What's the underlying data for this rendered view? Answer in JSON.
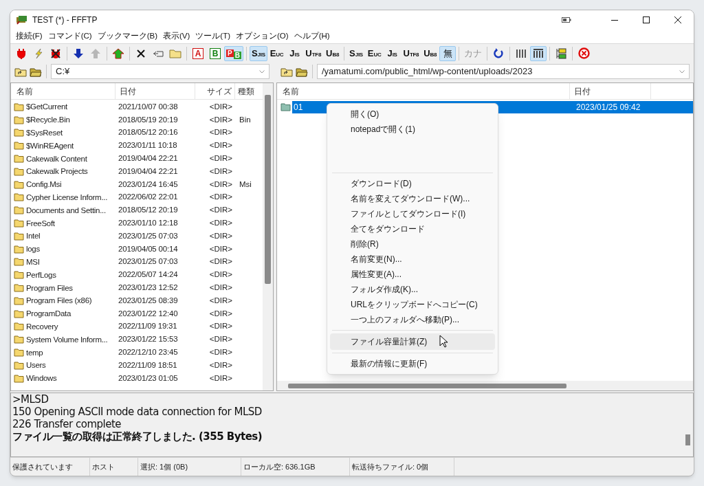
{
  "window": {
    "title": "TEST (*) - FFFTP"
  },
  "menu": [
    "接続(F)",
    "コマンド(C)",
    "ブックマーク(B)",
    "表示(V)",
    "ツール(T)",
    "オプション(O)",
    "ヘルプ(H)"
  ],
  "toolbar": [
    {
      "kind": "connect",
      "selected": false,
      "disabled": false
    },
    {
      "kind": "quick-connect",
      "selected": false,
      "disabled": false
    },
    {
      "kind": "disconnect",
      "selected": false,
      "disabled": false
    },
    {
      "kind": "sep"
    },
    {
      "kind": "download",
      "selected": false,
      "disabled": false
    },
    {
      "kind": "upload",
      "selected": false,
      "disabled": true
    },
    {
      "kind": "sep"
    },
    {
      "kind": "mirror",
      "selected": false,
      "disabled": false
    },
    {
      "kind": "sep"
    },
    {
      "kind": "delete",
      "selected": false,
      "disabled": false
    },
    {
      "kind": "rename",
      "selected": false,
      "disabled": false
    },
    {
      "kind": "mkdir",
      "selected": false,
      "disabled": false
    },
    {
      "kind": "sep"
    },
    {
      "kind": "boxed",
      "main": "A",
      "color": "#d01010",
      "selected": false,
      "disabled": false
    },
    {
      "kind": "boxed",
      "main": "B",
      "color": "#108010",
      "selected": false,
      "disabled": false
    },
    {
      "kind": "auto",
      "main": "P",
      "sub": "B",
      "selected": true,
      "disabled": false
    },
    {
      "kind": "sep"
    },
    {
      "kind": "letter",
      "main": "S",
      "sub": "JIS",
      "selected": true,
      "disabled": false
    },
    {
      "kind": "letter",
      "main": "E",
      "sub": "UC",
      "selected": false,
      "disabled": false
    },
    {
      "kind": "letter",
      "main": "J",
      "sub": "IS",
      "selected": false,
      "disabled": false
    },
    {
      "kind": "letter",
      "main": "U",
      "sub": "TF8",
      "selected": false,
      "disabled": false
    },
    {
      "kind": "letter",
      "main": "U",
      "sub": "B8",
      "selected": false,
      "disabled": false
    },
    {
      "kind": "sep"
    },
    {
      "kind": "letter",
      "main": "S",
      "sub": "JIS",
      "selected": false,
      "disabled": false
    },
    {
      "kind": "letter",
      "main": "E",
      "sub": "UC",
      "selected": false,
      "disabled": false
    },
    {
      "kind": "letter",
      "main": "J",
      "sub": "IS",
      "selected": false,
      "disabled": false
    },
    {
      "kind": "letter",
      "main": "U",
      "sub": "TF8",
      "selected": false,
      "disabled": false
    },
    {
      "kind": "letter",
      "main": "U",
      "sub": "B8",
      "selected": false,
      "disabled": false
    },
    {
      "kind": "glyph",
      "main": "無",
      "selected": true,
      "disabled": false
    },
    {
      "kind": "sep"
    },
    {
      "kind": "glyph",
      "main": "カナ",
      "selected": false,
      "disabled": true
    },
    {
      "kind": "sep"
    },
    {
      "kind": "refresh",
      "selected": false,
      "disabled": false
    },
    {
      "kind": "sep"
    },
    {
      "kind": "list-view",
      "selected": false,
      "disabled": false
    },
    {
      "kind": "detail-view",
      "selected": true,
      "disabled": false
    },
    {
      "kind": "sep"
    },
    {
      "kind": "tree",
      "selected": false,
      "disabled": false
    },
    {
      "kind": "sep"
    },
    {
      "kind": "stop",
      "selected": false,
      "disabled": false
    }
  ],
  "local": {
    "path": "C:¥",
    "columns": [
      "名前",
      "日付",
      "サイズ",
      "種類"
    ],
    "rows": [
      {
        "name": "$GetCurrent",
        "date": "2021/10/07 00:38",
        "size": "<DIR>"
      },
      {
        "name": "$Recycle.Bin",
        "date": "2018/05/19 20:19",
        "size": "<DIR>",
        "type": "Bin"
      },
      {
        "name": "$SysReset",
        "date": "2018/05/12 20:16",
        "size": "<DIR>"
      },
      {
        "name": "$WinREAgent",
        "date": "2023/01/11 10:18",
        "size": "<DIR>"
      },
      {
        "name": "Cakewalk Content",
        "date": "2019/04/04 22:21",
        "size": "<DIR>"
      },
      {
        "name": "Cakewalk Projects",
        "date": "2019/04/04 22:21",
        "size": "<DIR>"
      },
      {
        "name": "Config.Msi",
        "date": "2023/01/24 16:45",
        "size": "<DIR>",
        "type": "Msi"
      },
      {
        "name": "Cypher License Inform...",
        "date": "2022/06/02 22:01",
        "size": "<DIR>"
      },
      {
        "name": "Documents and Settin...",
        "date": "2018/05/12 20:19",
        "size": "<DIR>"
      },
      {
        "name": "FreeSoft",
        "date": "2023/01/10 12:18",
        "size": "<DIR>"
      },
      {
        "name": "Intel",
        "date": "2023/01/25 07:03",
        "size": "<DIR>"
      },
      {
        "name": "logs",
        "date": "2019/04/05 00:14",
        "size": "<DIR>"
      },
      {
        "name": "MSI",
        "date": "2023/01/25 07:03",
        "size": "<DIR>"
      },
      {
        "name": "PerfLogs",
        "date": "2022/05/07 14:24",
        "size": "<DIR>"
      },
      {
        "name": "Program Files",
        "date": "2023/01/23 12:52",
        "size": "<DIR>"
      },
      {
        "name": "Program Files (x86)",
        "date": "2023/01/25 08:39",
        "size": "<DIR>"
      },
      {
        "name": "ProgramData",
        "date": "2023/01/22 12:40",
        "size": "<DIR>"
      },
      {
        "name": "Recovery",
        "date": "2022/11/09 19:31",
        "size": "<DIR>"
      },
      {
        "name": "System Volume Inform...",
        "date": "2023/01/22 15:53",
        "size": "<DIR>"
      },
      {
        "name": "temp",
        "date": "2022/12/10 23:45",
        "size": "<DIR>"
      },
      {
        "name": "Users",
        "date": "2022/11/09 18:51",
        "size": "<DIR>"
      },
      {
        "name": "Windows",
        "date": "2023/01/23 01:05",
        "size": "<DIR>"
      }
    ]
  },
  "remote": {
    "path": "/yamatumi.com/public_html/wp-content/uploads/2023",
    "columns": [
      "名前",
      "日付"
    ],
    "rows": [
      {
        "name": "01",
        "date": "2023/01/25 09:42",
        "selected": true
      }
    ]
  },
  "context_menu": [
    {
      "kind": "item",
      "label": "開く(O)",
      "selected": false
    },
    {
      "kind": "item",
      "label": "notepadで開く(1)",
      "selected": false
    },
    {
      "kind": "blank"
    },
    {
      "kind": "sep"
    },
    {
      "kind": "item",
      "label": "ダウンロード(D)",
      "selected": false
    },
    {
      "kind": "item",
      "label": "名前を変えてダウンロード(W)...",
      "selected": false
    },
    {
      "kind": "item",
      "label": "ファイルとしてダウンロード(I)",
      "selected": false
    },
    {
      "kind": "item",
      "label": "全てをダウンロード",
      "selected": false
    },
    {
      "kind": "item",
      "label": "削除(R)",
      "selected": false
    },
    {
      "kind": "item",
      "label": "名前変更(N)...",
      "selected": false
    },
    {
      "kind": "item",
      "label": "属性変更(A)...",
      "selected": false
    },
    {
      "kind": "item",
      "label": "フォルダ作成(K)...",
      "selected": false
    },
    {
      "kind": "item",
      "label": "URLをクリップボードへコピー(C)",
      "selected": false
    },
    {
      "kind": "item",
      "label": "一つ上のフォルダへ移動(P)...",
      "selected": false
    },
    {
      "kind": "sep"
    },
    {
      "kind": "item",
      "label": "ファイル容量計算(Z)",
      "selected": true
    },
    {
      "kind": "sep"
    },
    {
      "kind": "item",
      "label": "最新の情報に更新(F)",
      "selected": false
    }
  ],
  "log": [
    {
      "text": ">MLSD",
      "bold": false
    },
    {
      "text": "150 Opening ASCII mode data connection for MLSD",
      "bold": false
    },
    {
      "text": "226 Transfer complete",
      "bold": false
    },
    {
      "text": "ファイル一覧の取得は正常終了しました. (355 Bytes)",
      "bold": true
    }
  ],
  "status_bar": [
    "保護されています",
    "ホスト",
    "選択: 1個 (0B)",
    "ローカル空: 636.1GB",
    "転送待ちファイル: 0個"
  ]
}
